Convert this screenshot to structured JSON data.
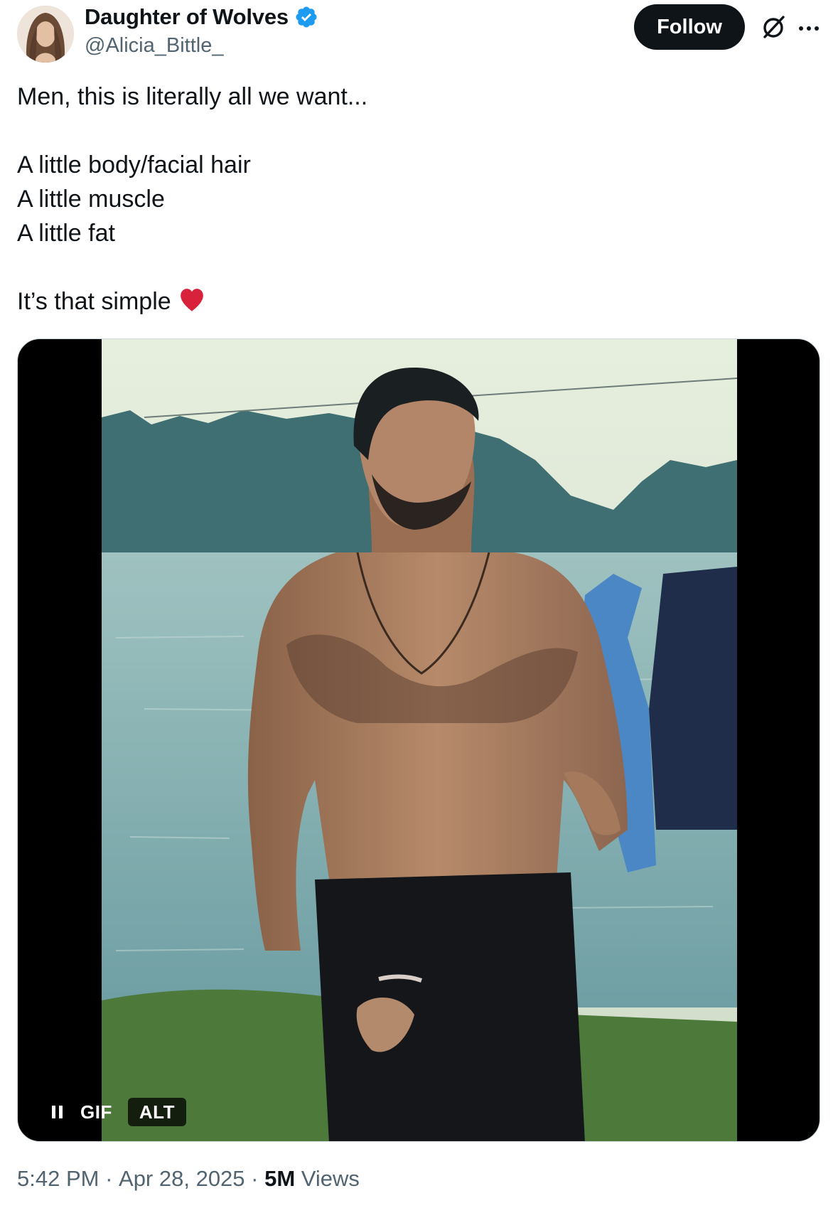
{
  "author": {
    "display_name": "Daughter of Wolves",
    "handle": "@Alicia_Bittle_",
    "verified": true
  },
  "header": {
    "follow_label": "Follow"
  },
  "tweet": {
    "lines": [
      "Men, this is literally all we want...",
      "",
      "A little body/facial hair",
      "A little muscle",
      "A little fat",
      "",
      "It’s that simple"
    ],
    "emoji": "red-heart"
  },
  "media": {
    "gif_label": "GIF",
    "alt_label": "ALT"
  },
  "meta": {
    "time": "5:42 PM",
    "separator": " · ",
    "date": "Apr 28, 2025",
    "views_count": "5M",
    "views_label": " Views"
  },
  "colors": {
    "primary_text": "#0f1419",
    "secondary_text": "#536471",
    "verified_blue": "#1d9bf0",
    "heart_red": "#d8213a",
    "follow_bg": "#0f1419"
  }
}
